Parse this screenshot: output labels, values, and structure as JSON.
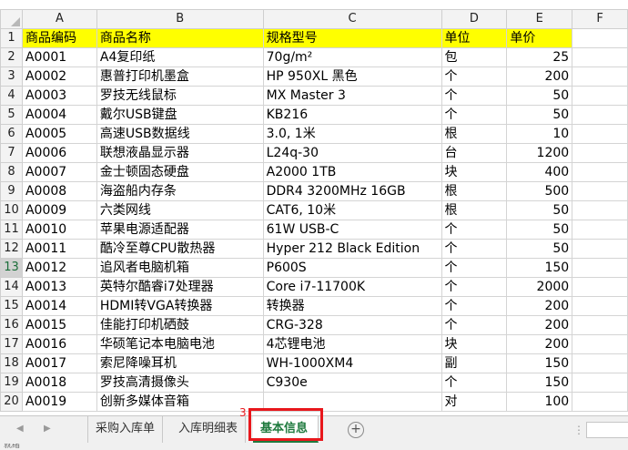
{
  "columns": [
    "A",
    "B",
    "C",
    "D",
    "E",
    "F"
  ],
  "rows": [
    {
      "n": "1",
      "cells": [
        "商品编码",
        "商品名称",
        "规格型号",
        "单位",
        "单价"
      ]
    },
    {
      "n": "2",
      "cells": [
        "A0001",
        "A4复印纸",
        "70g/m²",
        "包",
        "25"
      ]
    },
    {
      "n": "3",
      "cells": [
        "A0002",
        "惠普打印机墨盒",
        "HP 950XL 黑色",
        "个",
        "200"
      ]
    },
    {
      "n": "4",
      "cells": [
        "A0003",
        "罗技无线鼠标",
        "MX Master 3",
        "个",
        "50"
      ]
    },
    {
      "n": "5",
      "cells": [
        "A0004",
        "戴尔USB键盘",
        "KB216",
        "个",
        "50"
      ]
    },
    {
      "n": "6",
      "cells": [
        "A0005",
        "高速USB数据线",
        "3.0, 1米",
        "根",
        "10"
      ]
    },
    {
      "n": "7",
      "cells": [
        "A0006",
        "联想液晶显示器",
        "L24q-30",
        "台",
        "1200"
      ]
    },
    {
      "n": "8",
      "cells": [
        "A0007",
        "金士顿固态硬盘",
        "A2000 1TB",
        "块",
        "400"
      ]
    },
    {
      "n": "9",
      "cells": [
        "A0008",
        "海盗船内存条",
        "DDR4 3200MHz 16GB",
        "根",
        "500"
      ]
    },
    {
      "n": "10",
      "cells": [
        "A0009",
        "六类网线",
        "CAT6, 10米",
        "根",
        "50"
      ]
    },
    {
      "n": "11",
      "cells": [
        "A0010",
        "苹果电源适配器",
        "61W USB-C",
        "个",
        "50"
      ]
    },
    {
      "n": "12",
      "cells": [
        "A0011",
        "酷冷至尊CPU散热器",
        "Hyper 212 Black Edition",
        "个",
        "50"
      ]
    },
    {
      "n": "13",
      "cells": [
        "A0012",
        "追风者电脑机箱",
        "P600S",
        "个",
        "150"
      ]
    },
    {
      "n": "14",
      "cells": [
        "A0013",
        "英特尔酷睿i7处理器",
        "Core i7-11700K",
        "个",
        "2000"
      ]
    },
    {
      "n": "15",
      "cells": [
        "A0014",
        "HDMI转VGA转换器",
        "转换器",
        "个",
        "200"
      ]
    },
    {
      "n": "16",
      "cells": [
        "A0015",
        "佳能打印机硒鼓",
        "CRG-328",
        "个",
        "200"
      ]
    },
    {
      "n": "17",
      "cells": [
        "A0016",
        "华硕笔记本电脑电池",
        "4芯锂电池",
        "块",
        "200"
      ]
    },
    {
      "n": "18",
      "cells": [
        "A0017",
        "索尼降噪耳机",
        "WH-1000XM4",
        "副",
        "150"
      ]
    },
    {
      "n": "19",
      "cells": [
        "A0018",
        "罗技高清摄像头",
        "C930e",
        "个",
        "150"
      ]
    },
    {
      "n": "20",
      "cells": [
        "A0019",
        "创新多媒体音箱",
        "",
        "对",
        "100"
      ]
    }
  ],
  "tabs": {
    "sheet1": "采购入库单",
    "sheet2": "入库明细表",
    "sheet3": "基本信息",
    "add": "+",
    "badge": "3"
  },
  "nav": {
    "prev": "◀",
    "next": "▶",
    "more": "⋮"
  },
  "status": {
    "ready": "就绪"
  },
  "colors": {
    "header_fill": "#ffff00",
    "accent": "#1f7a3e",
    "highlight": "#e8171c"
  }
}
